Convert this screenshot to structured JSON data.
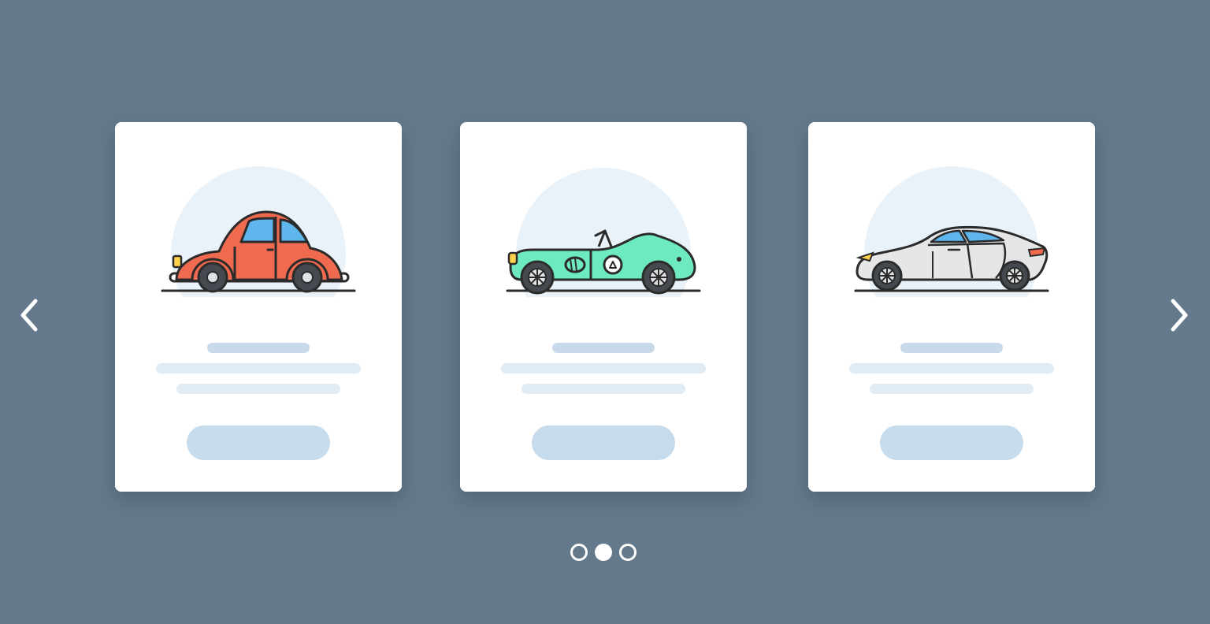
{
  "carousel": {
    "prev_icon": "chevron-left-icon",
    "next_icon": "chevron-right-icon",
    "active_index": 1,
    "cards": [
      {
        "car_icon": "beetle-car-icon",
        "body_color": "#ef6a4f",
        "window_color": "#5fb6ec"
      },
      {
        "car_icon": "roadster-car-icon",
        "body_color": "#6eeac0",
        "window_color": "#ffffff"
      },
      {
        "car_icon": "sports-car-icon",
        "body_color": "#e4e6e8",
        "window_color": "#5fb6ec"
      }
    ],
    "dots": [
      {
        "state": "inactive"
      },
      {
        "state": "active"
      },
      {
        "state": "inactive"
      }
    ]
  },
  "colors": {
    "background": "#647a8c",
    "card": "#ffffff",
    "placeholder_title": "#c8daea",
    "placeholder_line": "#e1ebf3",
    "placeholder_button": "#c6dbeb",
    "halo": "#e9f2f9"
  }
}
